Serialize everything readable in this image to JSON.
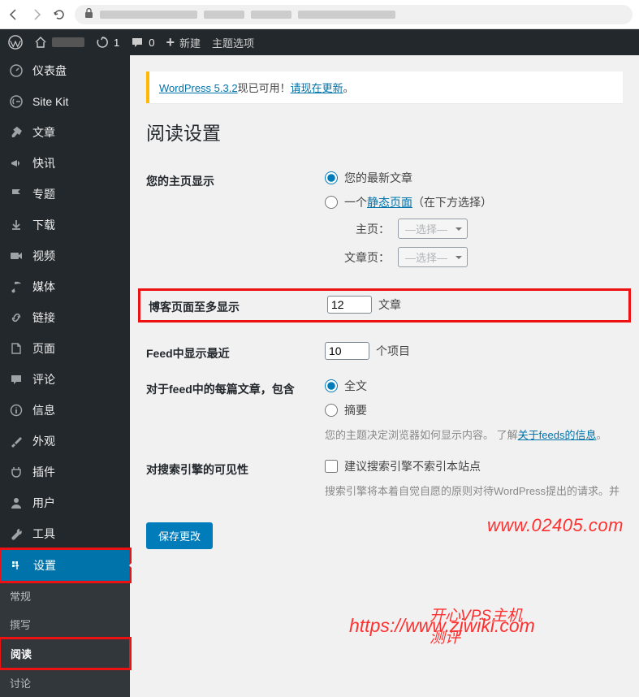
{
  "adminBar": {
    "refresh_count": "1",
    "comments_count": "0",
    "new_label": "新建",
    "theme_options": "主题选项"
  },
  "sidebar": {
    "items": [
      {
        "icon": "dashboard",
        "label": "仪表盘"
      },
      {
        "icon": "sitekit",
        "label": "Site Kit"
      },
      {
        "icon": "pin",
        "label": "文章"
      },
      {
        "icon": "megaphone",
        "label": "快讯"
      },
      {
        "icon": "flag",
        "label": "专题"
      },
      {
        "icon": "download",
        "label": "下载"
      },
      {
        "icon": "video",
        "label": "视频"
      },
      {
        "icon": "media",
        "label": "媒体"
      },
      {
        "icon": "link",
        "label": "链接"
      },
      {
        "icon": "page",
        "label": "页面"
      },
      {
        "icon": "comment",
        "label": "评论"
      },
      {
        "icon": "info",
        "label": "信息"
      },
      {
        "icon": "appearance",
        "label": "外观"
      },
      {
        "icon": "plugin",
        "label": "插件"
      },
      {
        "icon": "user",
        "label": "用户"
      },
      {
        "icon": "tools",
        "label": "工具"
      },
      {
        "icon": "settings",
        "label": "设置"
      }
    ],
    "submenu": [
      {
        "label": "常规"
      },
      {
        "label": "撰写"
      },
      {
        "label": "阅读"
      },
      {
        "label": "讨论"
      }
    ]
  },
  "content": {
    "update_notice_prefix": "WordPress 5.3.2",
    "update_notice_mid": "现已可用！",
    "update_notice_link": "请现在更新",
    "update_notice_end": "。",
    "page_title": "阅读设置",
    "form": {
      "homepage_label": "您的主页显示",
      "homepage_opt1": "您的最新文章",
      "homepage_opt2_pre": "一个",
      "homepage_opt2_link": "静态页面",
      "homepage_opt2_post": "（在下方选择）",
      "front_page_label": "主页：",
      "posts_page_label": "文章页：",
      "select_placeholder": "—选择—",
      "posts_per_page_label": "博客页面至多显示",
      "posts_per_page_value": "12",
      "posts_per_page_unit": "文章",
      "feed_items_label": "Feed中显示最近",
      "feed_items_value": "10",
      "feed_items_unit": "个项目",
      "feed_content_label": "对于feed中的每篇文章，包含",
      "feed_full": "全文",
      "feed_summary": "摘要",
      "feed_desc_pre": "您的主题决定浏览器如何显示内容。",
      "feed_desc_mid": "了解",
      "feed_desc_link": "关于feeds的信息",
      "feed_desc_end": "。",
      "seo_label": "对搜索引擎的可见性",
      "seo_checkbox_label": "建议搜索引擎不索引本站点",
      "seo_desc": "搜索引擎将本着自觉自愿的原则对待WordPress提出的请求。并",
      "submit_label": "保存更改"
    }
  },
  "watermarks": {
    "w1": "www.02405.com",
    "w2_pre": "https://",
    "w2_text": "开心VPS主机测评",
    "w2_url": "www.zjwiki.com"
  }
}
